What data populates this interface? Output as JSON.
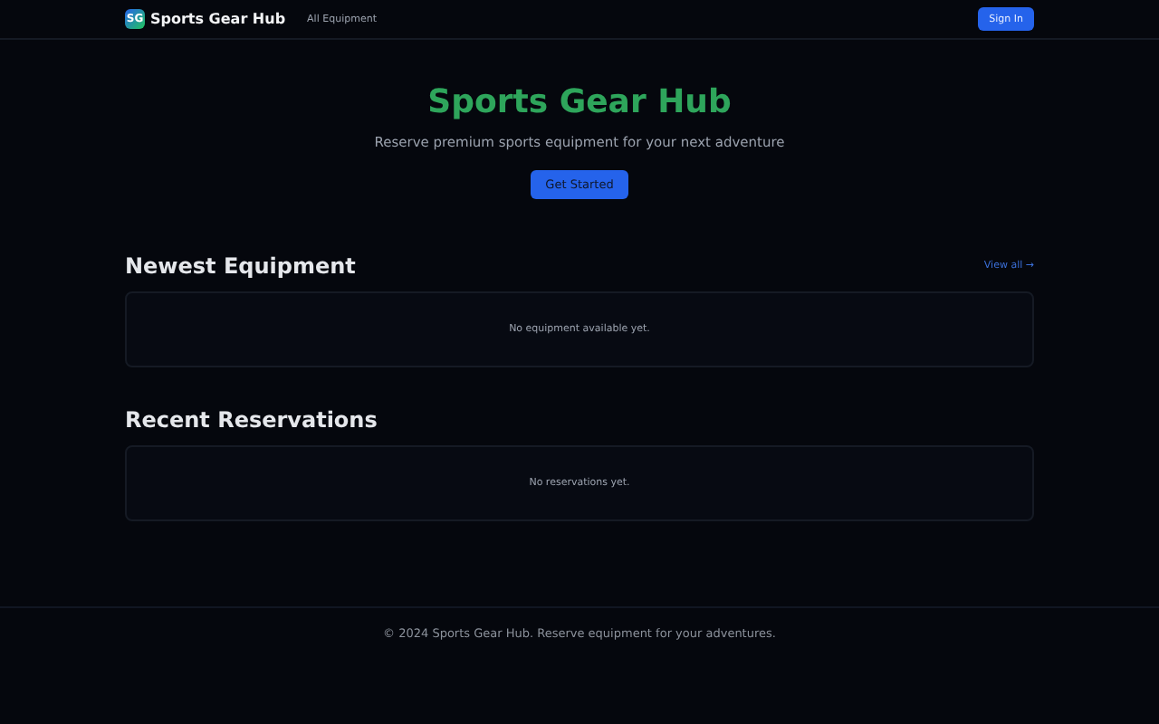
{
  "nav": {
    "logo": "SG",
    "brand": "Sports Gear Hub",
    "links": [
      "All Equipment"
    ],
    "button": "Sign In"
  },
  "hero": {
    "title": "Sports Gear Hub",
    "subtitle": "Reserve premium sports equipment for your next adventure",
    "button": "Get Started"
  },
  "sections": [
    {
      "title": "Newest Equipment",
      "link": "View all →",
      "empty": "No equipment available yet."
    },
    {
      "title": "Recent Reservations",
      "empty": "No reservations yet."
    }
  ],
  "footer": "© 2024 Sports Gear Hub. Reserve equipment for your adventures."
}
